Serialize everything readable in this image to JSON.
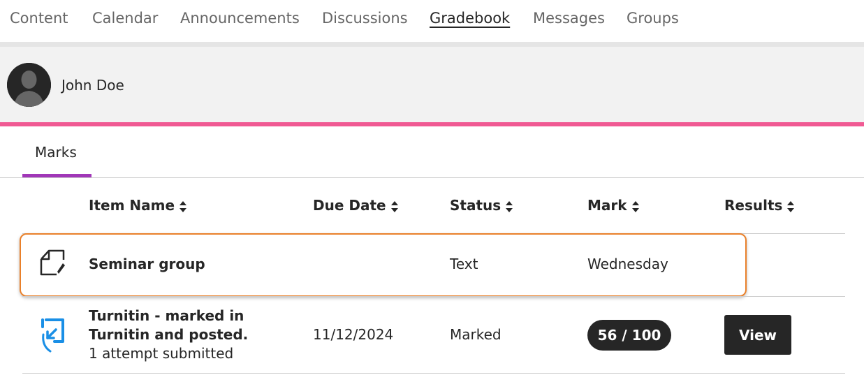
{
  "nav": {
    "items": [
      {
        "label": "Content",
        "active": false
      },
      {
        "label": "Calendar",
        "active": false
      },
      {
        "label": "Announcements",
        "active": false
      },
      {
        "label": "Discussions",
        "active": false
      },
      {
        "label": "Gradebook",
        "active": true
      },
      {
        "label": "Messages",
        "active": false
      },
      {
        "label": "Groups",
        "active": false
      }
    ]
  },
  "user": {
    "name": "John Doe",
    "avatar_icon": "user-silhouette-icon"
  },
  "tabs": {
    "marks_label": "Marks"
  },
  "table": {
    "columns": [
      "Item Name",
      "Due Date",
      "Status",
      "Mark",
      "Results"
    ],
    "rows": [
      {
        "icon": "assignment-pen-icon",
        "name": "Seminar group",
        "due_date": "",
        "status": "Text",
        "mark": "Wednesday",
        "results": ""
      },
      {
        "icon": "turnitin-icon",
        "name_line1": "Turnitin - marked in",
        "name_line2": "Turnitin and posted.",
        "subtext": "1 attempt submitted",
        "due_date": "11/12/2024",
        "status": "Marked",
        "mark": "56 / 100",
        "results": "View"
      }
    ]
  },
  "colors": {
    "accent_pink": "#f05a93",
    "tab_purple": "#a137b8",
    "highlight_orange": "#e9802a",
    "turnitin_blue": "#1a8fe6"
  }
}
